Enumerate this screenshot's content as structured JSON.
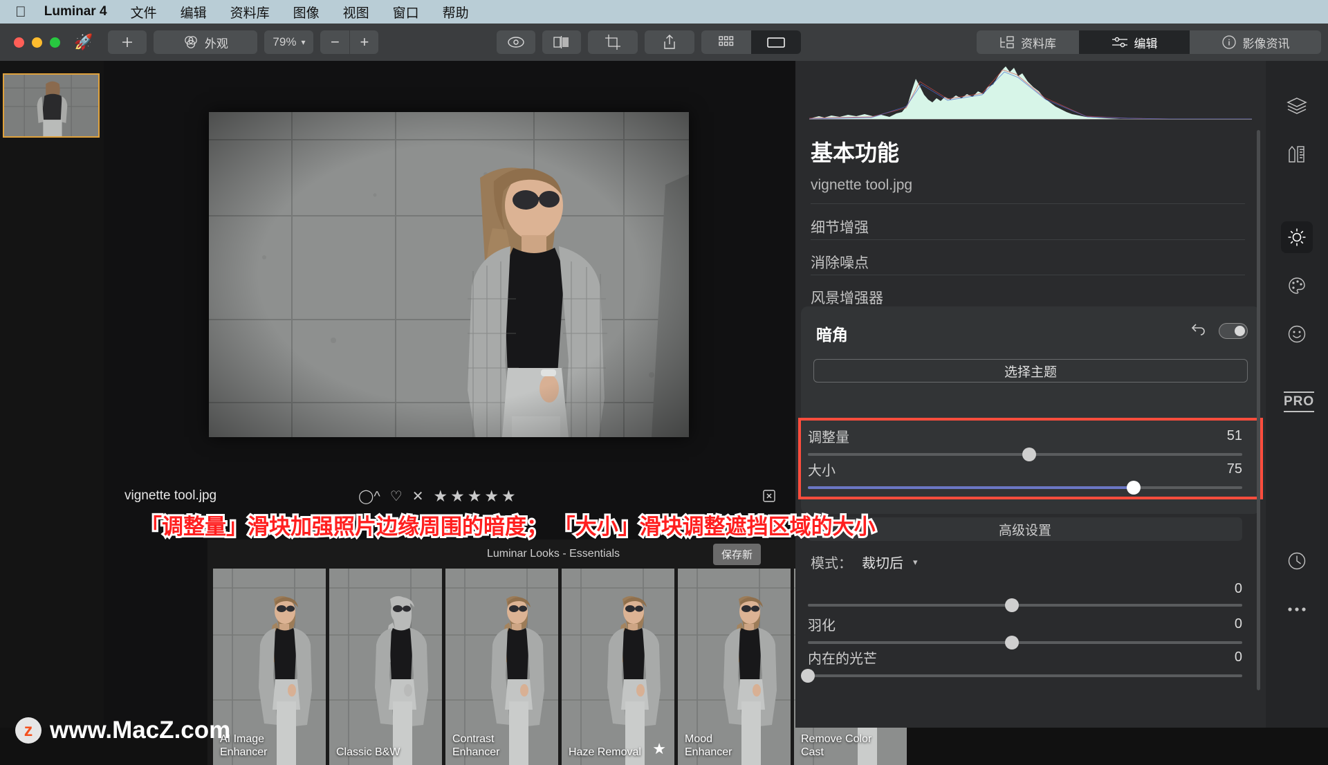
{
  "menubar": {
    "apple_icon": "apple-logo",
    "app_name": "Luminar 4",
    "items": [
      "文件",
      "编辑",
      "资料库",
      "图像",
      "视图",
      "窗口",
      "帮助"
    ]
  },
  "toolbar": {
    "add_label": "+",
    "looks_label": "外观",
    "zoom_value": "79%",
    "zoom_out": "−",
    "zoom_in": "+",
    "preview_icon": "eye-icon",
    "compare_icon": "split-compare-icon",
    "crop_icon": "crop-icon",
    "share_icon": "share-icon",
    "grid_icon": "grid-view-icon",
    "single_icon": "single-view-icon",
    "library_label": "资料库",
    "edit_label": "编辑",
    "info_label": "影像资讯"
  },
  "canvas": {
    "filename": "vignette tool.jpg",
    "reject_icon": "x-reject-icon",
    "flag_icon": "flag-icon",
    "like_icon": "heart-icon",
    "stars": "★★★★★",
    "trash_icon": "trash-icon"
  },
  "looks": {
    "header": "Luminar Looks - Essentials",
    "save_label": "保存新",
    "presets": [
      {
        "label": "AI Image\nEnhancer",
        "starred": false
      },
      {
        "label": "Classic B&W",
        "starred": false
      },
      {
        "label": "Contrast\nEnhancer",
        "starred": false
      },
      {
        "label": "Haze Removal",
        "starred": true
      },
      {
        "label": "Mood\nEnhancer",
        "starred": false
      },
      {
        "label": "Remove Color\nCast",
        "starred": false
      }
    ]
  },
  "right_panel": {
    "title": "基本功能",
    "file_label": "vignette tool.jpg",
    "tools": [
      "细节增强",
      "消除噪点",
      "风景增强器"
    ],
    "vignette": {
      "title": "暗角",
      "undo_icon": "undo-icon",
      "toggle_icon": "toggle-switch-on",
      "choose_subject_label": "选择主题",
      "sliders": [
        {
          "label": "调整量",
          "value": "51",
          "percent": 51
        },
        {
          "label": "大小",
          "value": "75",
          "percent": 75
        }
      ],
      "advanced_label": "高级设置",
      "mode_label": "模式：",
      "mode_value": "裁切后",
      "advanced_sliders": [
        {
          "label": "",
          "value": "0",
          "percent": 47
        },
        {
          "label": "羽化",
          "value": "0",
          "percent": 47
        },
        {
          "label": "内在的光芒",
          "value": "0",
          "percent": 0
        }
      ]
    }
  },
  "icon_rail": {
    "items": [
      {
        "name": "layers-icon",
        "selected": false
      },
      {
        "name": "tools-icon",
        "selected": false
      },
      {
        "name": "brightness-icon",
        "selected": true
      },
      {
        "name": "palette-icon",
        "selected": false
      },
      {
        "name": "portrait-icon",
        "selected": false
      },
      {
        "name": "pro-label",
        "selected": false,
        "label": "PRO"
      },
      {
        "name": "history-icon",
        "selected": false
      },
      {
        "name": "more-icon",
        "selected": false
      }
    ]
  },
  "annotations": {
    "callout": "「调整量」滑块加强照片边缘周围的暗度； 「大小」滑块调整遮挡区域的大小",
    "highlight_color": "#ff4d3d"
  },
  "watermark": {
    "badge": "z",
    "text": "www.MacZ.com"
  }
}
